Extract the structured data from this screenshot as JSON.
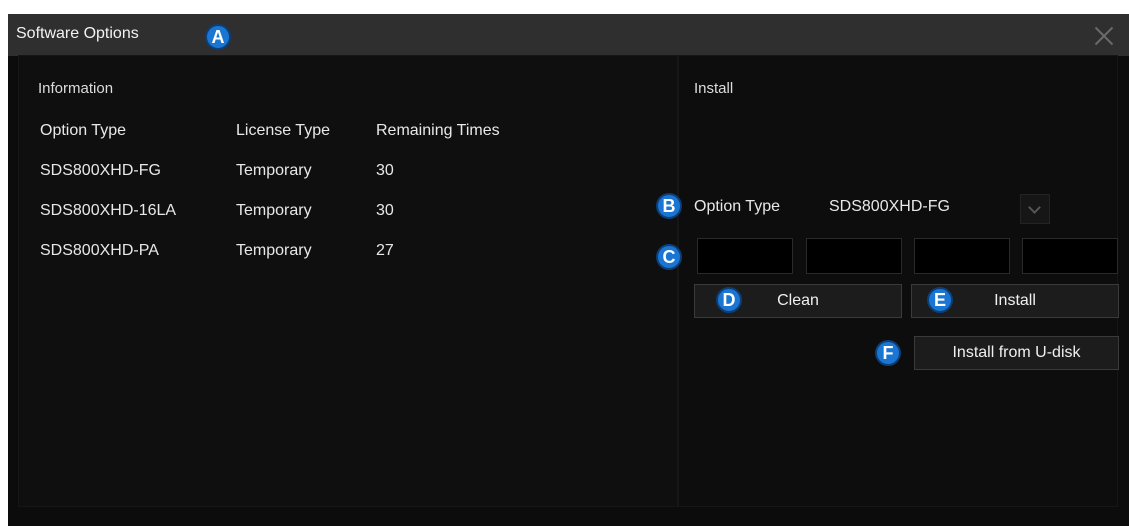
{
  "window": {
    "title": "Software Options"
  },
  "info": {
    "section_title": "Information",
    "columns": [
      "Option Type",
      "License Type",
      "Remaining Times"
    ],
    "rows": [
      [
        "SDS800XHD-FG",
        "Temporary",
        "30"
      ],
      [
        "SDS800XHD-16LA",
        "Temporary",
        "30"
      ],
      [
        "SDS800XHD-PA",
        "Temporary",
        "27"
      ]
    ]
  },
  "install": {
    "section_title": "Install",
    "option_type_label": "Option Type",
    "option_type_value": "SDS800XHD-FG",
    "code_fields": [
      "",
      "",
      "",
      ""
    ],
    "clean_label": "Clean",
    "install_label": "Install",
    "install_udisk_label": "Install from U-disk"
  },
  "badges": {
    "a": "A",
    "b": "B",
    "c": "C",
    "d": "D",
    "e": "E",
    "f": "F"
  },
  "colors": {
    "badge": "#1a76d2",
    "titlebar": "#2f2f2f",
    "background": "#0c0c0c"
  },
  "icons": {
    "close": "close-icon",
    "select": "chevron-down-icon"
  }
}
